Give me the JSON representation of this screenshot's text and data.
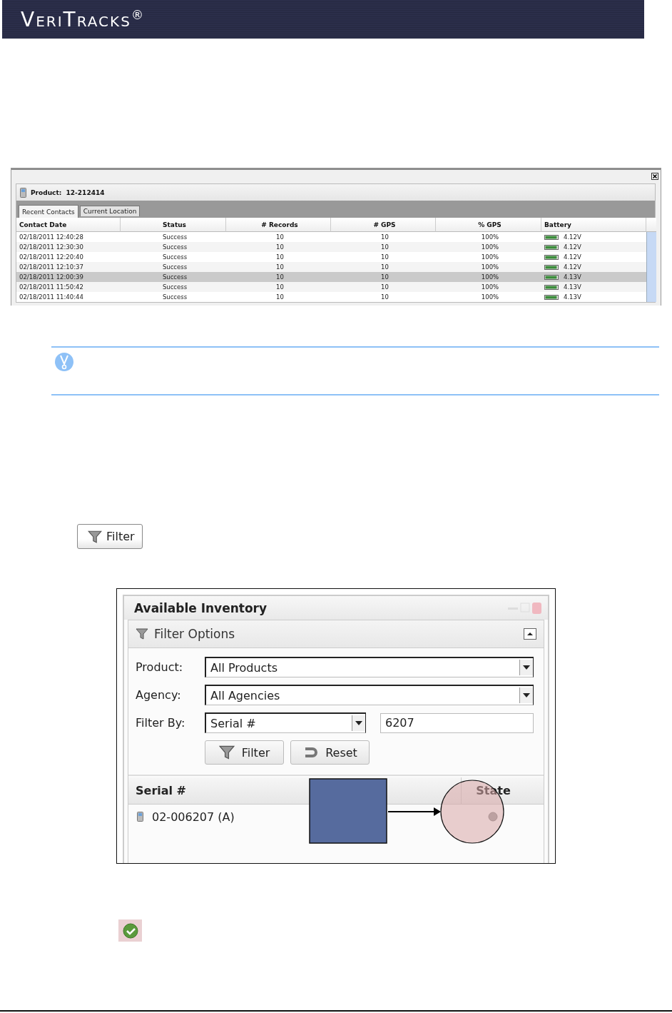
{
  "header": {
    "logo": "VeriTracks$^{®}$"
  },
  "product_window": {
    "product_label": "Product:",
    "product_id": "12-212414",
    "tabs": [
      {
        "label": "Recent Contacts",
        "selected": true
      },
      {
        "label": "Current Location",
        "selected": false
      }
    ],
    "columns": [
      "Contact Date",
      "Status",
      "# Records",
      "# GPS",
      "% GPS",
      "Battery"
    ],
    "rows": [
      {
        "cells": [
          "02/18/2011 12:40:28",
          "Success",
          "10",
          "10",
          "100%",
          "4.12V"
        ],
        "selected": false
      },
      {
        "cells": [
          "02/18/2011 12:30:30",
          "Success",
          "10",
          "10",
          "100%",
          "4.12V"
        ],
        "selected": false
      },
      {
        "cells": [
          "02/18/2011 12:20:40",
          "Success",
          "10",
          "10",
          "100%",
          "4.12V"
        ],
        "selected": false
      },
      {
        "cells": [
          "02/18/2011 12:10:37",
          "Success",
          "10",
          "10",
          "100%",
          "4.12V"
        ],
        "selected": false
      },
      {
        "cells": [
          "02/18/2011 12:00:39",
          "Success",
          "10",
          "10",
          "100%",
          "4.13V"
        ],
        "selected": true
      },
      {
        "cells": [
          "02/18/2011 11:50:42",
          "Success",
          "10",
          "10",
          "100%",
          "4.13V"
        ],
        "selected": false
      },
      {
        "cells": [
          "02/18/2011 11:40:44",
          "Success",
          "10",
          "10",
          "100%",
          "4.13V"
        ],
        "selected": false
      }
    ]
  },
  "filter_button": {
    "label": "Filter"
  },
  "inventory": {
    "title": "Available Inventory",
    "section": "Filter Options",
    "fields": [
      {
        "label": "Product:",
        "kind": "select",
        "value": "All Products"
      },
      {
        "label": "Agency:",
        "kind": "select",
        "value": "All Agencies"
      },
      {
        "label": "Filter By:",
        "kind": "select_text",
        "value": "Serial #",
        "text": "6207"
      }
    ],
    "buttons": [
      {
        "label": "Filter",
        "kind": "filter"
      },
      {
        "label": "Reset",
        "kind": "reset"
      }
    ],
    "columns": [
      "Serial #",
      "State"
    ],
    "rows": [
      {
        "serial": "02-006207 (A)"
      }
    ]
  }
}
